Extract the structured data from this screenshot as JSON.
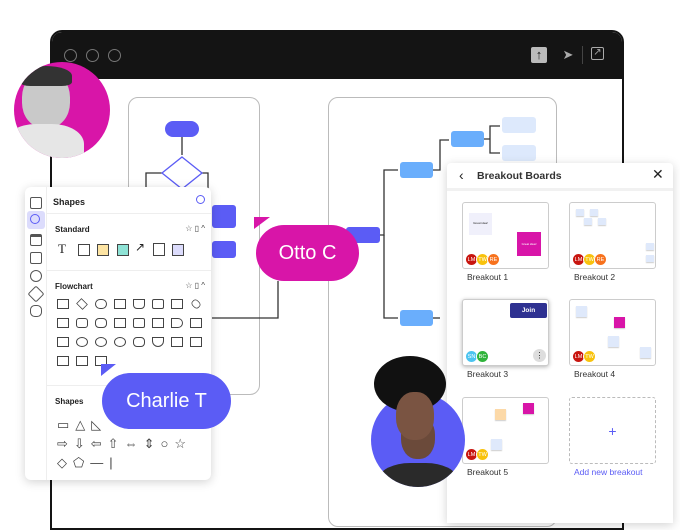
{
  "window": {
    "controls": [
      "circle",
      "circle",
      "circle"
    ],
    "toolbar_icons": [
      "upload-icon",
      "send-icon",
      "external-link-icon"
    ]
  },
  "colors": {
    "accent_purple": "#5b5cf5",
    "magenta": "#d815a8",
    "light_blue": "#6aaefc",
    "pale_blue": "#dde9fc",
    "titlebar": "#141414",
    "join": "#2e3191"
  },
  "shapes_panel": {
    "title": "Shapes",
    "rail_icons": [
      "layout-icon",
      "shapes-icon",
      "frame-icon",
      "image-icon",
      "database-icon",
      "rocket-icon",
      "puzzle-icon"
    ],
    "sections": [
      {
        "title": "Standard"
      },
      {
        "title": "Flowchart"
      },
      {
        "title": "Shapes"
      }
    ]
  },
  "cursors": {
    "otto": "Otto C",
    "charlie": "Charlie T"
  },
  "breakout": {
    "title": "Breakout Boards",
    "boards": [
      {
        "label": "Breakout 1",
        "avatars": [
          "LM",
          "TW",
          "RE"
        ],
        "notes": [
          "Great idea!",
          "Great idea!"
        ]
      },
      {
        "label": "Breakout 2",
        "avatars": [
          "LM",
          "TW",
          "RE"
        ]
      },
      {
        "label": "Breakout 3",
        "avatars": [
          "SN",
          "BC"
        ],
        "join_label": "Join"
      },
      {
        "label": "Breakout 4",
        "avatars": [
          "LM",
          "TW"
        ]
      },
      {
        "label": "Breakout 5",
        "avatars": [
          "LM",
          "TW"
        ]
      }
    ],
    "add_label": "Add new breakout",
    "add_icon": "+"
  }
}
